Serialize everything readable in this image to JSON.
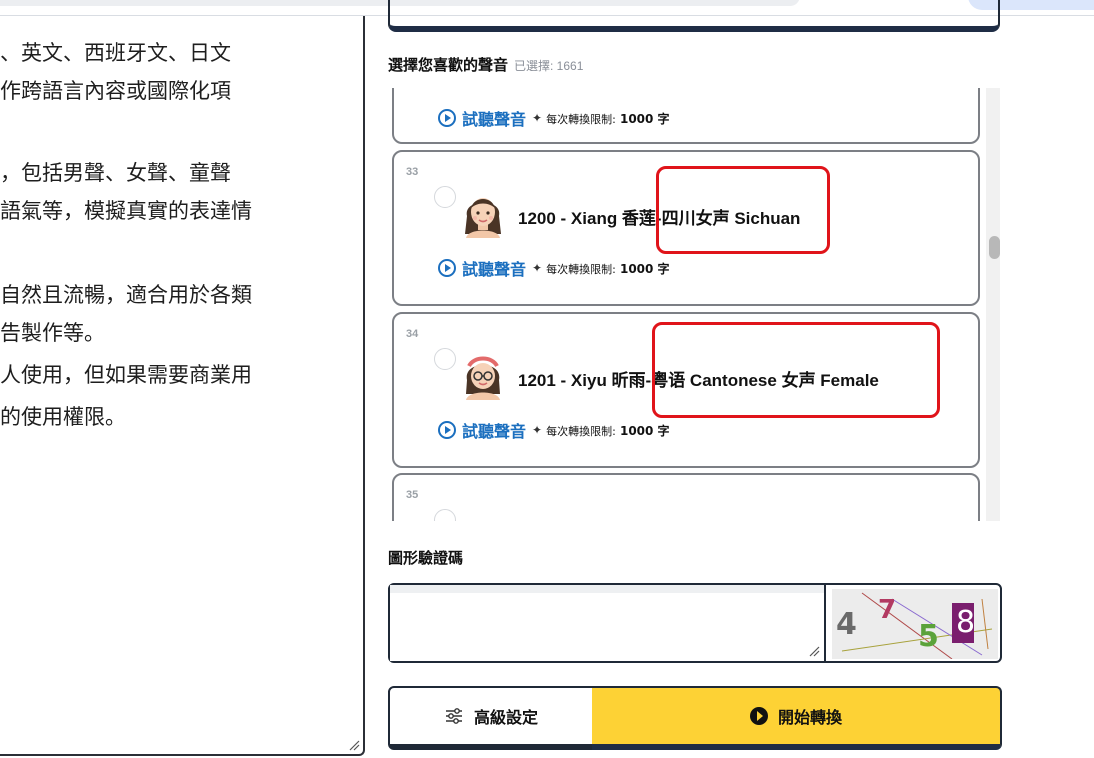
{
  "left_text": {
    "lines": [
      "、英文、西班牙文、日文",
      "作跨語言內容或國際化項",
      "，包括男聲、女聲、童聲",
      "語氣等，模擬真實的表達情",
      "自然且流暢，適合用於各類",
      "告製作等。",
      "人使用，但如果需要商業用",
      "的使用權限。"
    ]
  },
  "voice_section": {
    "title": "選擇您喜歡的聲音",
    "selected_label": "已選擇: 1661"
  },
  "voice_cards": [
    {
      "number": "",
      "name": "",
      "listen_label": "試聽聲音",
      "limit_label": "每次轉換限制:",
      "limit_value": "1000 字"
    },
    {
      "number": "33",
      "name": "1200 - Xiang 香莲-四川女声 Sichuan",
      "listen_label": "試聽聲音",
      "limit_label": "每次轉換限制:",
      "limit_value": "1000 字",
      "avatar": "woman-avatar-icon"
    },
    {
      "number": "34",
      "name": "1201 - Xiyu 昕雨-粤语 Cantonese 女声 Female",
      "listen_label": "試聽聲音",
      "limit_label": "每次轉換限制:",
      "limit_value": "1000 字",
      "avatar": "woman-glasses-avatar-icon"
    },
    {
      "number": "35",
      "name": "",
      "avatar": "woman-avatar-icon"
    }
  ],
  "captcha": {
    "title": "圖形驗證碼",
    "input_value": "",
    "image_chars": [
      "4",
      "7",
      "5",
      "8"
    ]
  },
  "buttons": {
    "advanced_label": "高級設定",
    "start_label": "開始轉換"
  },
  "colors": {
    "accent_blue": "#1b6fbf",
    "start_yellow": "#fdd235",
    "highlight_red": "#e0141a",
    "frame_dark": "#1f2937"
  }
}
